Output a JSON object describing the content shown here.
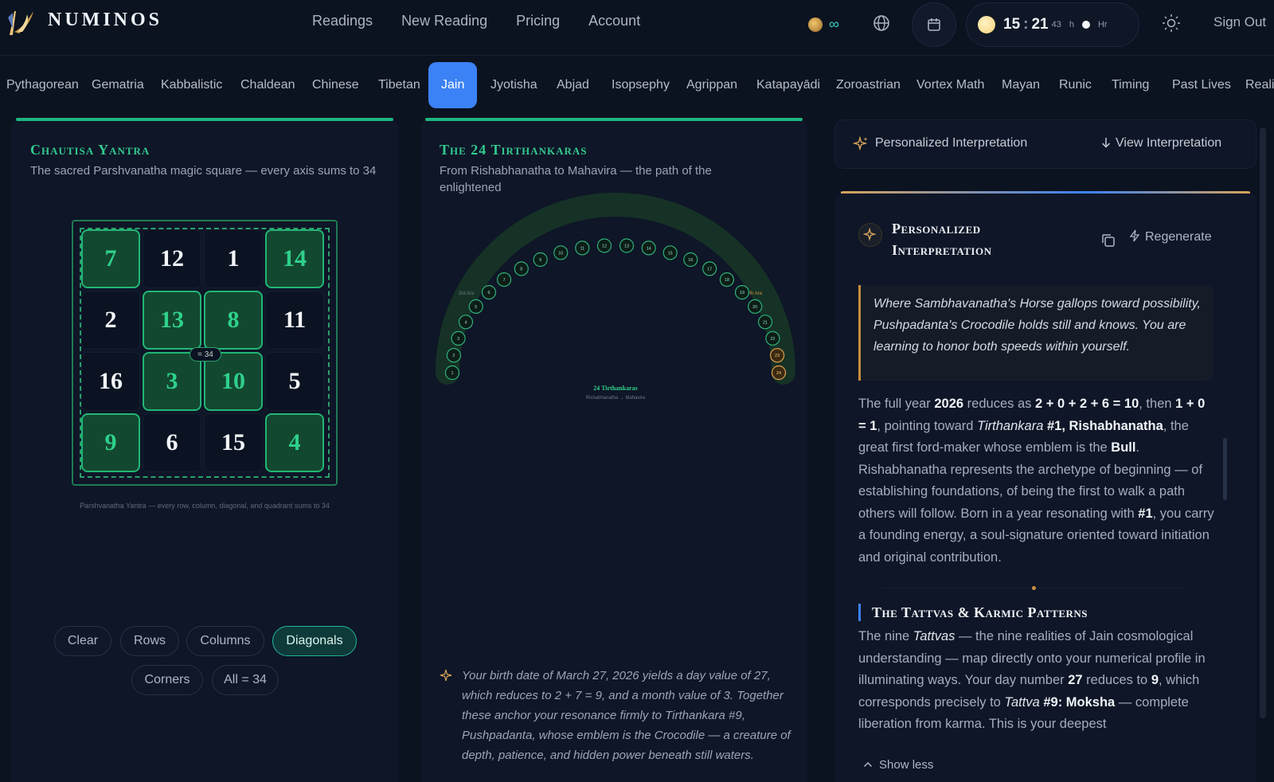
{
  "brand": {
    "name": "NUMINOS"
  },
  "nav": {
    "items": [
      "Readings",
      "New Reading",
      "Pricing",
      "Account"
    ]
  },
  "header": {
    "credits_value": "∞",
    "clock": {
      "hour": "15",
      "minute": "21",
      "seconds": "43",
      "unit_h": "h",
      "unit_hr": "Hr"
    },
    "sign_out": "Sign Out"
  },
  "systems": {
    "tabs": [
      "Pythagorean",
      "Gematria",
      "Kabbalistic",
      "Chaldean",
      "Chinese",
      "Tibetan",
      "Jain",
      "Jyotisha",
      "Abjad",
      "Isopsephy",
      "Agrippan",
      "Katapayādi",
      "Zoroastrian",
      "Vortex Math",
      "Mayan",
      "Runic",
      "Timing",
      "Past Lives",
      "Reali"
    ],
    "active": "Jain"
  },
  "yantra": {
    "title": "Chautisa Yantra",
    "subtitle": "The sacred Parshvanatha magic square — every axis sums to 34",
    "grid": [
      [
        7,
        12,
        1,
        14
      ],
      [
        2,
        13,
        8,
        11
      ],
      [
        16,
        3,
        10,
        5
      ],
      [
        9,
        6,
        15,
        4
      ]
    ],
    "highlighted": [
      [
        0,
        0
      ],
      [
        0,
        3
      ],
      [
        1,
        1
      ],
      [
        1,
        2
      ],
      [
        2,
        1
      ],
      [
        2,
        2
      ],
      [
        3,
        0
      ],
      [
        3,
        3
      ]
    ],
    "center_sum": "= 34",
    "caption": "Parshvanatha Yantra — every row, column, diagonal, and quadrant sums to 34",
    "buttons": {
      "clear": "Clear",
      "rows": "Rows",
      "columns": "Columns",
      "diagonals": "Diagonals",
      "corners": "Corners",
      "all": "All = 34"
    },
    "active_mode": "Diagonals"
  },
  "tirthankaras": {
    "title": "The 24 Tirthankaras",
    "subtitle": "From Rishabhanatha to Mahavira — the path of the enlightened",
    "count": 24,
    "highlighted": [
      23,
      24
    ],
    "left_era": "3rd Ara",
    "right_era": "4th Ara",
    "center_title": "24 Tirthankaras",
    "center_sub": "Rishabhanatha → Mahavira",
    "birth_note": "Your birth date of March 27, 2026 yields a day value of 27, which reduces to 2 + 7 = 9, and a month value of 3. Together these anchor your resonance firmly to Tirthankara #9, Pushpadanta, whose emblem is the Crocodile — a creature of depth, patience, and hidden power beneath still waters."
  },
  "interpretation": {
    "bar_label": "Personalized Interpretation",
    "view_label": "View Interpretation",
    "card_title": "Personalized Interpretation",
    "regenerate": "Regenerate",
    "quote": "Where Sambhavanatha's Horse gallops toward possibility, Pushpadanta's Crocodile holds still and knows. You are learning to honor both speeds within yourself.",
    "para1": {
      "t1": "The full year ",
      "year": "2026",
      "t2": " reduces as ",
      "calc": "2 + 0 + 2 + 6 = 10",
      "t3": ", then ",
      "calc2": "1 + 0 = 1",
      "t4": ", pointing toward ",
      "tir": "Tirthankara",
      "num": "#1, Rishabhanatha",
      "t5": ", the great first ford-maker whose emblem is the ",
      "emblem": "Bull",
      "t6": ". Rishabhanatha represents the archetype of beginning — of establishing foundations, of being the first to walk a path others will follow. Born in a year resonating with ",
      "num2": "#1",
      "t7": ", you carry a founding energy, a soul-signature oriented toward initiation and original contribution."
    },
    "section_title": "The Tattvas & Karmic Patterns",
    "para2": {
      "t1": "The nine ",
      "tattvas": "Tattvas",
      "t2": " — the nine realities of Jain cosmological understanding — map directly onto your numerical profile in illuminating ways. Your day number ",
      "day": "27",
      "t3": " reduces to ",
      "nine": "9",
      "t4": ", which corresponds precisely to ",
      "tattva": "Tattva",
      "t5num": "#9: Moksha",
      "t6": " — complete liberation from karma. This is your deepest"
    },
    "show_less": "Show less"
  },
  "colors": {
    "accent_green": "#22b676",
    "accent_blue": "#3b82f6",
    "accent_gold": "#d7a35a",
    "background": "#0b1220"
  }
}
